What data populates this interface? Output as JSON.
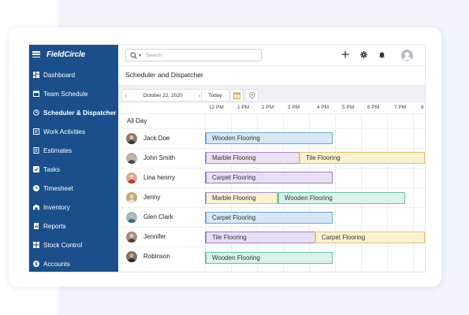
{
  "app": {
    "logo": "FieldCircle"
  },
  "sidebar": {
    "items": [
      {
        "label": "Dashboard",
        "icon": "dashboard-icon"
      },
      {
        "label": "Team Schedule",
        "icon": "calendar-icon"
      },
      {
        "label": "Scheduler & Dispatcher",
        "icon": "dispatch-icon",
        "active": true
      },
      {
        "label": "Work Activities",
        "icon": "work-icon"
      },
      {
        "label": "Estimates",
        "icon": "estimate-icon"
      },
      {
        "label": "Tasks",
        "icon": "task-icon"
      },
      {
        "label": "Timesheet",
        "icon": "clock-icon"
      },
      {
        "label": "Inventory",
        "icon": "inventory-icon"
      },
      {
        "label": "Reports",
        "icon": "report-icon"
      },
      {
        "label": "Stock Control",
        "icon": "stock-icon"
      },
      {
        "label": "Accounts",
        "icon": "accounts-icon"
      }
    ]
  },
  "topbar": {
    "search_placeholder": "Search",
    "icons": [
      "plus-icon",
      "gear-icon",
      "bell-icon",
      "user-avatar-icon"
    ]
  },
  "page": {
    "title": "Scheduler and Dispatcher"
  },
  "toolbar": {
    "prev": "‹",
    "date": "October 22, 2020",
    "next": "›",
    "today": "Today"
  },
  "timeline": {
    "ticks": [
      "12 PM",
      "1 PM",
      "2 PM",
      "3 PM",
      "4 PM",
      "5 PM",
      "6 PM",
      "7 PM",
      "8"
    ],
    "all_day_label": "All Day"
  },
  "rows": [
    {
      "name": "Jack Doe",
      "jobs": [
        {
          "label": "Wooden Flooring",
          "type": "wood"
        }
      ]
    },
    {
      "name": "John Smith",
      "jobs": [
        {
          "label": "Marble Flooring",
          "type": "marble"
        },
        {
          "label": "Tile Flooring",
          "type": "tile"
        }
      ]
    },
    {
      "name": "Lina henrry",
      "jobs": [
        {
          "label": "Carpet Flooring",
          "type": "carpet"
        }
      ]
    },
    {
      "name": "Jenny",
      "jobs": [
        {
          "label": "Marble Flooring",
          "type": "tile"
        },
        {
          "label": "Wooden Flooring",
          "type": "teal"
        }
      ]
    },
    {
      "name": "Glen Clark",
      "jobs": [
        {
          "label": "Carpet Flooring",
          "type": "wood"
        }
      ]
    },
    {
      "name": "Jennifer",
      "jobs": [
        {
          "label": "Tile Flooring",
          "type": "carpet"
        },
        {
          "label": "Carpet Flooring",
          "type": "tile"
        }
      ]
    },
    {
      "name": "Robinson",
      "jobs": [
        {
          "label": "Wooden Flooring",
          "type": "teal"
        }
      ]
    }
  ]
}
